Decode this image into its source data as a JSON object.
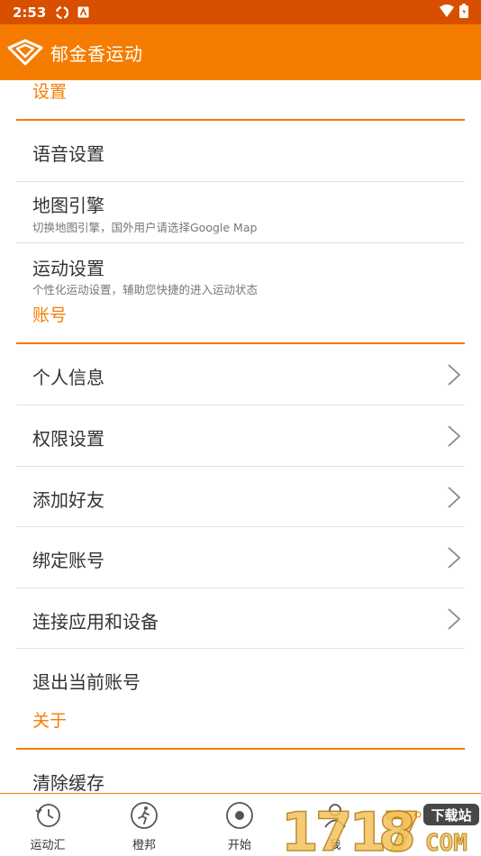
{
  "status_bar": {
    "time": "2:53"
  },
  "app_bar": {
    "title": "郁金香运动"
  },
  "sections": {
    "settings": "设置",
    "account": "账号",
    "about": "关于"
  },
  "settings_items": {
    "voice": {
      "label": "语音设置"
    },
    "map": {
      "label": "地图引擎",
      "sub": "切换地图引擎，国外用户请选择Google Map"
    },
    "sport": {
      "label": "运动设置",
      "sub": "个性化运动设置，辅助您快捷的进入运动状态"
    }
  },
  "account_items": {
    "profile": "个人信息",
    "permissions": "权限设置",
    "add_friend": "添加好友",
    "bind": "绑定账号",
    "connect": "连接应用和设备",
    "logout": "退出当前账号"
  },
  "about_items": {
    "clear_cache": "清除缓存"
  },
  "bottom_nav": [
    {
      "label": "运动汇",
      "icon": "clock-icon"
    },
    {
      "label": "橙邦",
      "icon": "runner-icon"
    },
    {
      "label": "开始",
      "icon": "record-icon"
    },
    {
      "label": "我",
      "icon": "person-icon"
    }
  ],
  "watermark": {
    "text": "1717 8.COM 下载站"
  },
  "colors": {
    "accent": "#f57c00",
    "status": "#d84f00"
  }
}
